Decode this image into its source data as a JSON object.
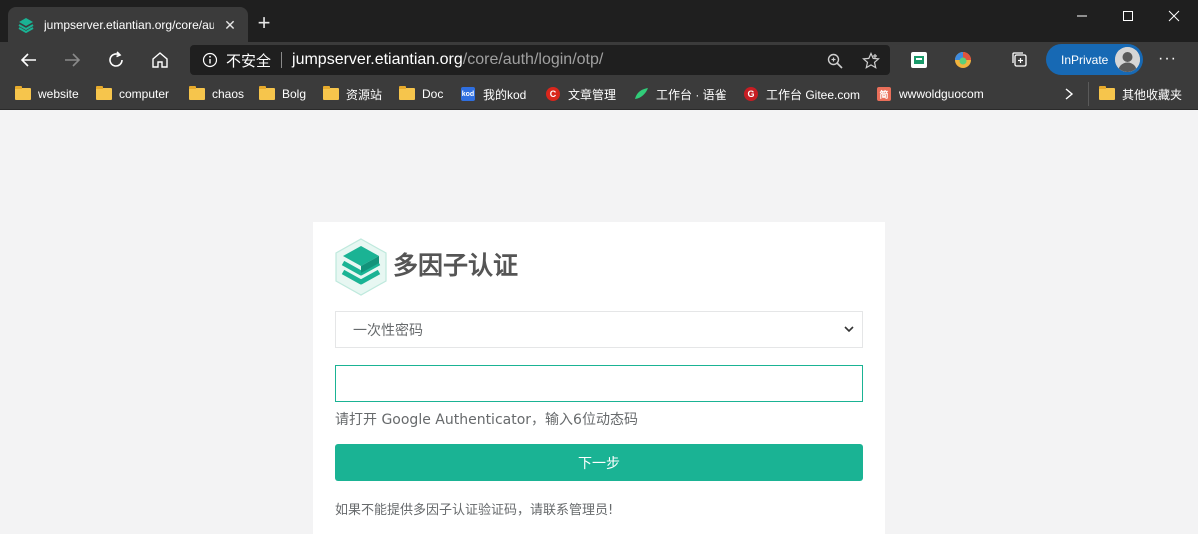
{
  "browser": {
    "tab": {
      "title": "jumpserver.etiantian.org/core/auth/login/otp/",
      "close_glyph": "✕"
    },
    "new_tab_glyph": "+",
    "address": {
      "security_label": "不安全",
      "host": "jumpserver.etiantian.org",
      "path": "/core/auth/login/otp/"
    },
    "inprivate_label": "InPrivate",
    "more_glyph": "···"
  },
  "bookmarks": [
    {
      "label": "website",
      "icon": "folder-icon"
    },
    {
      "label": "computer",
      "icon": "folder-icon"
    },
    {
      "label": "chaos",
      "icon": "folder-icon"
    },
    {
      "label": "Bolg",
      "icon": "folder-icon"
    },
    {
      "label": "资源站",
      "icon": "folder-icon"
    },
    {
      "label": "Doc",
      "icon": "folder-icon"
    },
    {
      "label": "我的kod",
      "icon": "kod-icon",
      "badge": "kod"
    },
    {
      "label": "文章管理",
      "icon": "csdn-icon",
      "badge": "C"
    },
    {
      "label": "工作台 · 语雀",
      "icon": "yuque-icon"
    },
    {
      "label": "工作台 Gitee.com",
      "icon": "gitee-icon",
      "badge": "G"
    },
    {
      "label": "wwwoldguocom",
      "icon": "jian-icon",
      "badge": "简"
    }
  ],
  "bookmarks_other": "其他收藏夹",
  "login": {
    "title": "多因子认证",
    "method_selected": "一次性密码",
    "code_value": "",
    "hint": "请打开 Google Authenticator，输入6位动态码",
    "next_label": "下一步",
    "contact_text": "如果不能提供多因子认证验证码，请联系管理员!"
  },
  "colors": {
    "accent": "#1ab394",
    "inprivate": "#1769b4",
    "chrome_dark": "#1f1f1f",
    "chrome": "#3b3b3b"
  }
}
